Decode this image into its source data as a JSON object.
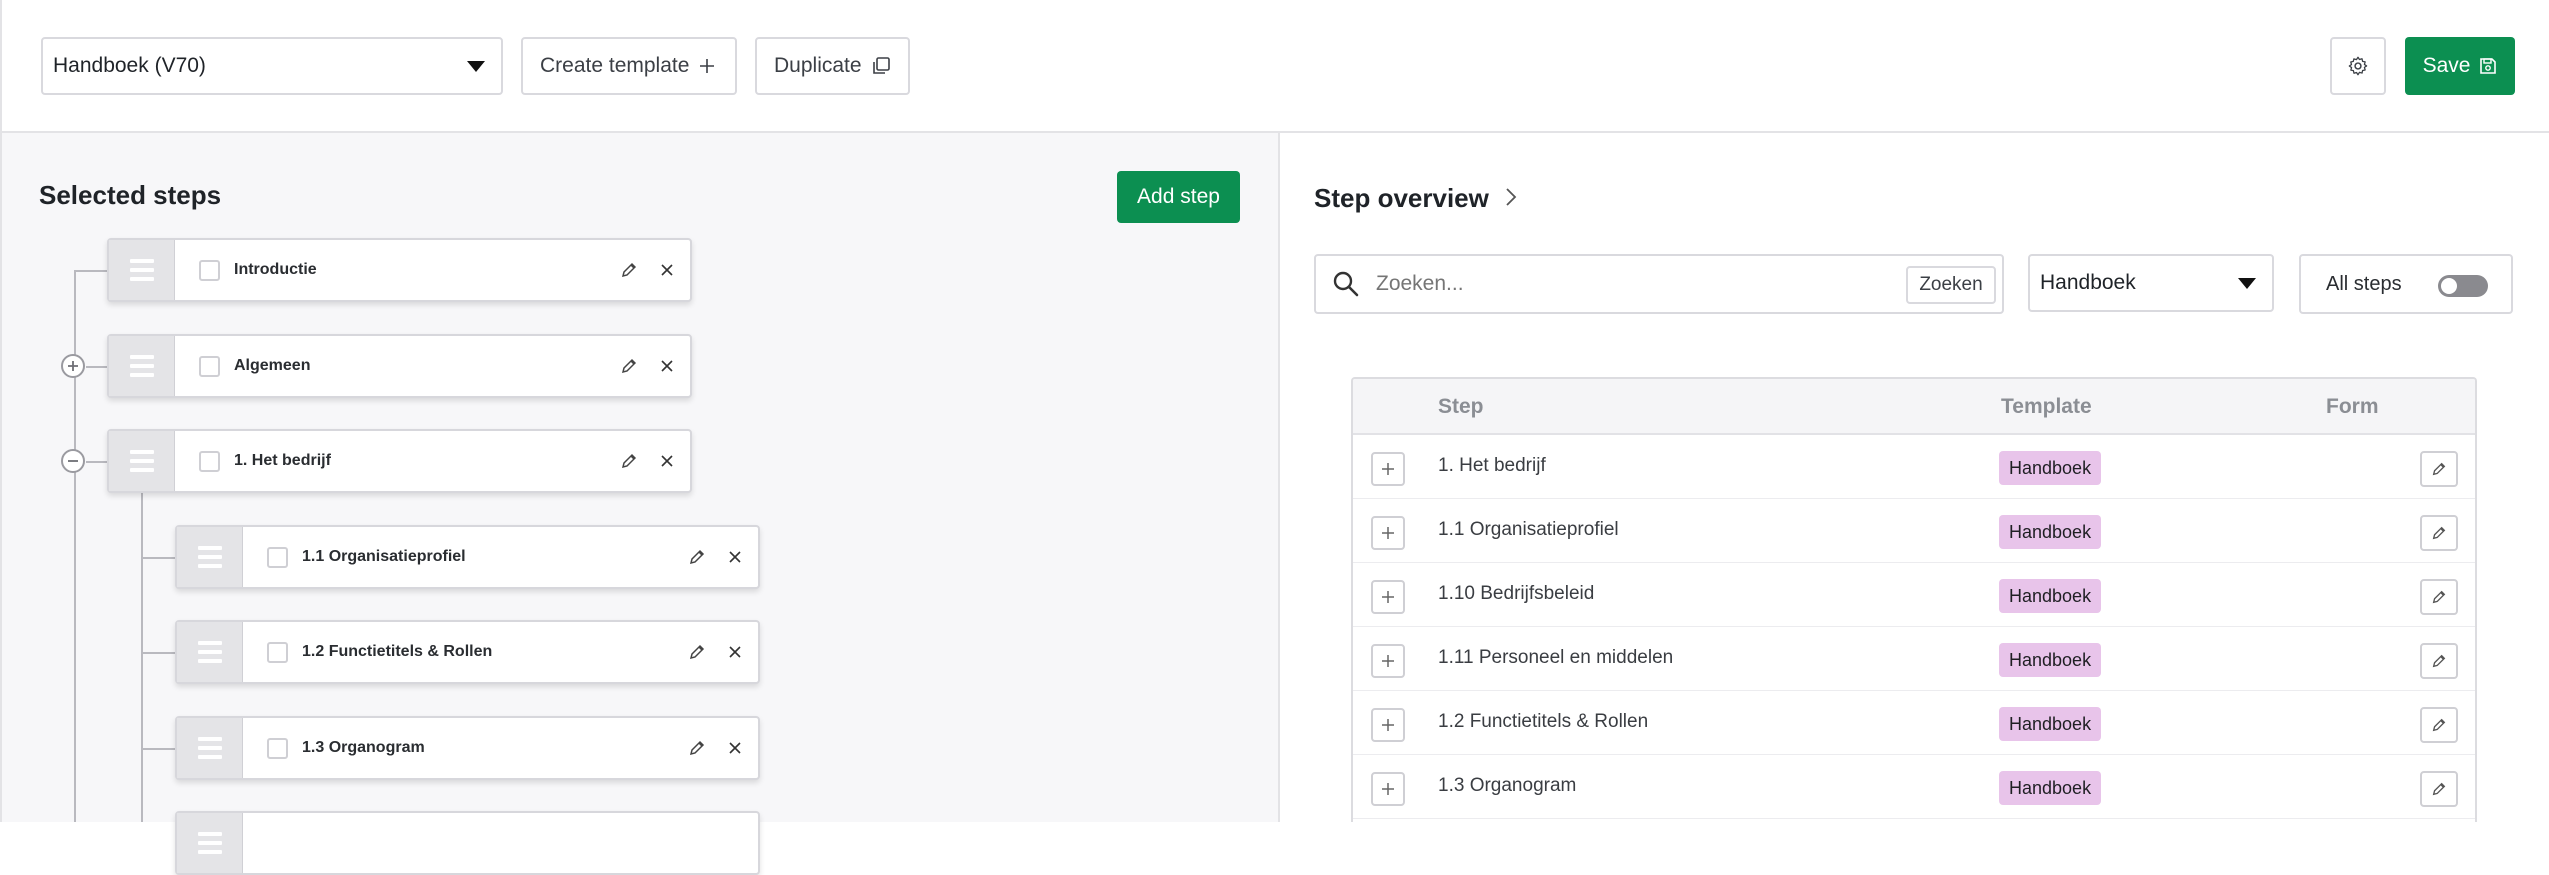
{
  "header": {
    "template_select": "Handboek (V70)",
    "create_template_label": "Create template",
    "duplicate_label": "Duplicate",
    "save_label": "Save",
    "settings_icon": "gear-icon"
  },
  "selected_steps": {
    "title": "Selected steps",
    "add_step_label": "Add step",
    "items": [
      {
        "label": "Introductie"
      },
      {
        "label": "Algemeen"
      },
      {
        "label": "1. Het bedrijf"
      },
      {
        "label": "1.1 Organisatieprofiel"
      },
      {
        "label": "1.2 Functietitels & Rollen"
      },
      {
        "label": "1.3 Organogram"
      }
    ]
  },
  "step_overview": {
    "title": "Step overview",
    "search_placeholder": "Zoeken...",
    "search_button": "Zoeken",
    "filter_select": "Handboek",
    "all_steps_label": "All steps",
    "all_steps_on": false,
    "columns": [
      "Step",
      "Template",
      "Form"
    ],
    "rows": [
      {
        "step": "1. Het bedrijf",
        "template": "Handboek"
      },
      {
        "step": "1.1 Organisatieprofiel",
        "template": "Handboek"
      },
      {
        "step": "1.10 Bedrijfsbeleid",
        "template": "Handboek"
      },
      {
        "step": "1.11 Personeel en middelen",
        "template": "Handboek"
      },
      {
        "step": "1.2 Functietitels & Rollen",
        "template": "Handboek"
      },
      {
        "step": "1.3 Organogram",
        "template": "Handboek"
      }
    ]
  },
  "colors": {
    "primary_green": "#0c8f51",
    "badge_pink": "#e8c4ea"
  }
}
